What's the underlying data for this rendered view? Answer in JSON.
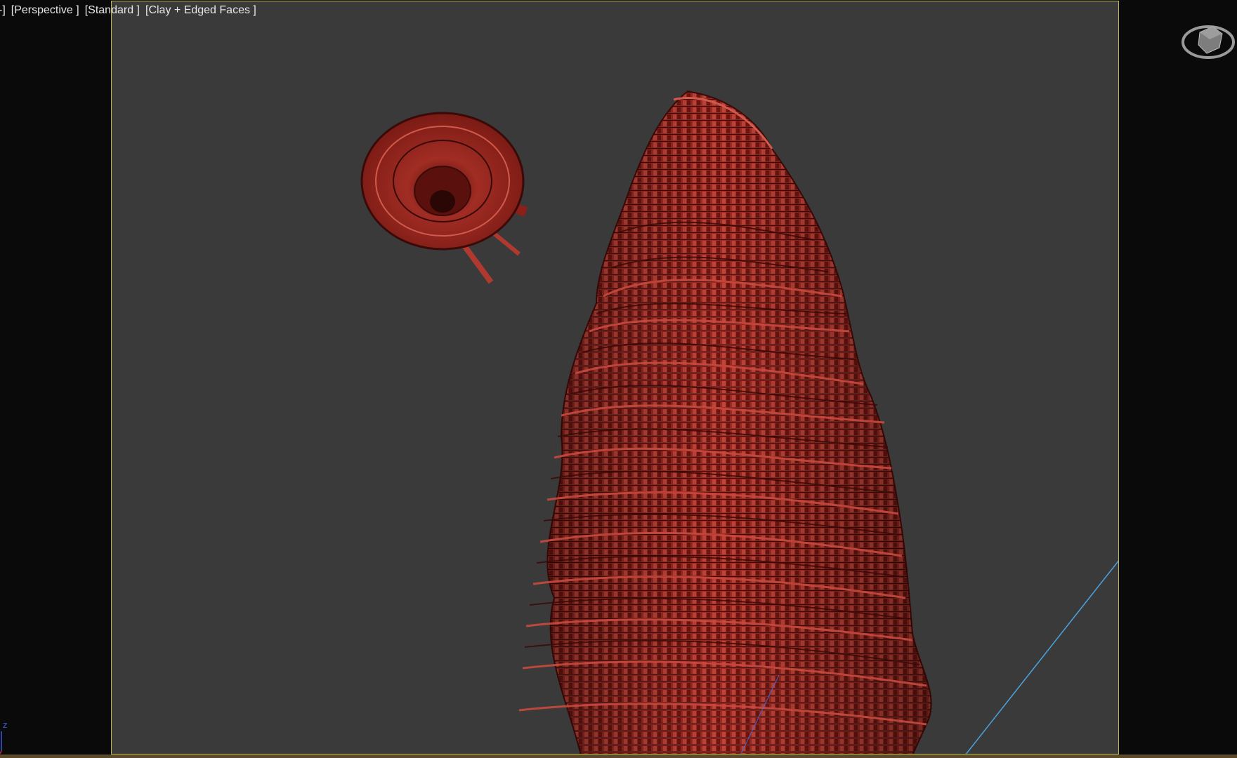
{
  "viewport": {
    "labels": {
      "prefix": "-]",
      "view": "[Perspective ]",
      "shading_preset": "[Standard ]",
      "display_mode": "[Clay + Edged Faces ]"
    },
    "axis_label": "z",
    "colors": {
      "background": "#3a3a3a",
      "border_active": "#bdb84a",
      "margin": "#0a0a0a",
      "model": "#8b1f1a",
      "edges": "#3a0a08",
      "grid_line": "#4aa3e0"
    },
    "icons": {
      "viewcube": "viewcube-icon",
      "axis_tripod": "axis-tripod-icon"
    }
  }
}
